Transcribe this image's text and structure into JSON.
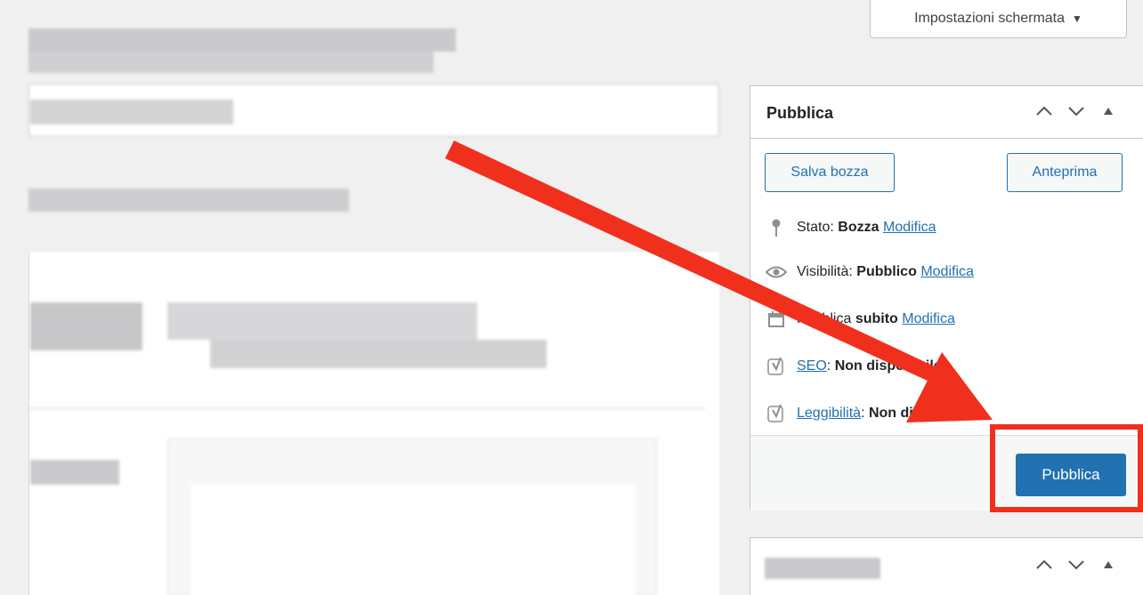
{
  "screen_options": {
    "label": "Impostazioni schermata",
    "toggle_glyph": "▼"
  },
  "publish_box": {
    "title": "Pubblica",
    "save_draft_label": "Salva bozza",
    "preview_label": "Anteprima",
    "status": {
      "label": "Stato:",
      "value": "Bozza",
      "link": "Modifica"
    },
    "visibility": {
      "label": "Visibilità:",
      "value": "Pubblico",
      "link": "Modifica"
    },
    "schedule": {
      "label": "Pubblica",
      "value": "subito",
      "link": "Modifica"
    },
    "seo": {
      "link": "SEO",
      "separator": ":",
      "value": "Non disponibile"
    },
    "readability": {
      "link": "Leggibilità",
      "separator": ":",
      "value": "Non disponibile"
    },
    "publish_label": "Pubblica"
  },
  "icons": [
    "pin-icon",
    "eye-icon",
    "calendar-icon",
    "yoast-icon",
    "chevron-up-icon",
    "chevron-down-icon",
    "triangle-up-icon"
  ],
  "colors": {
    "accent": "#2271b1",
    "annotation": "#f0301c"
  }
}
